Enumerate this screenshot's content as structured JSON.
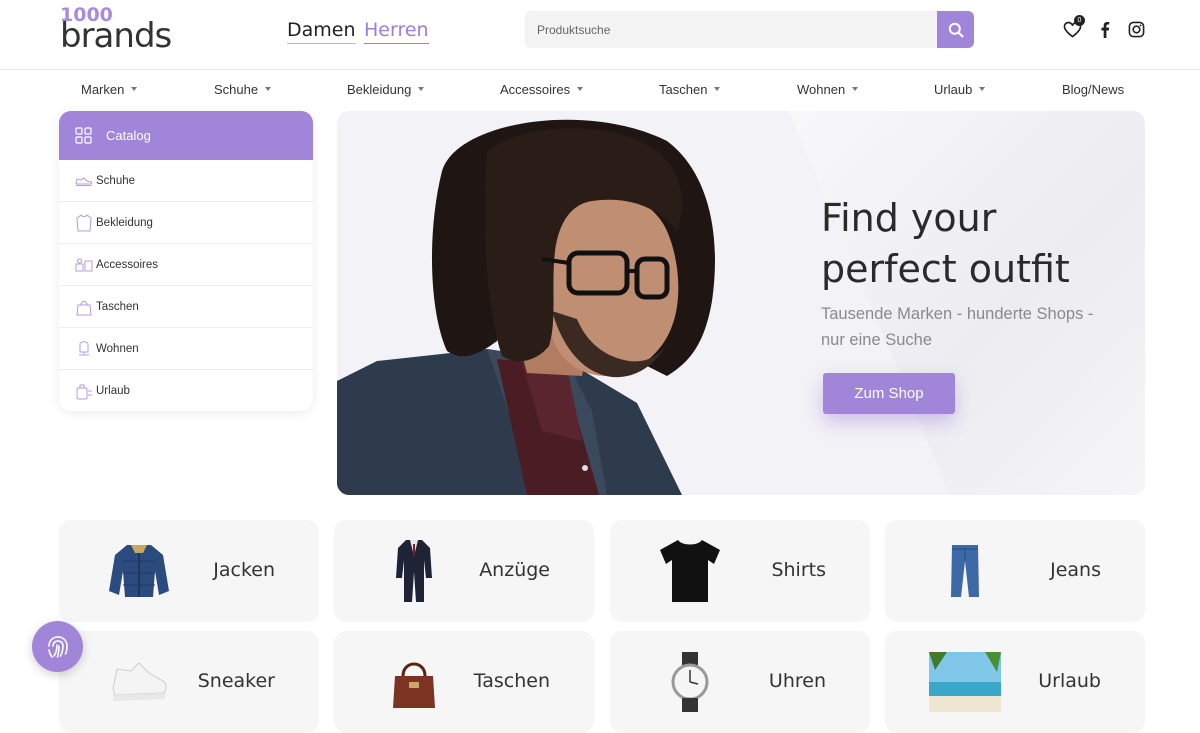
{
  "header": {
    "logo_num": "1000",
    "logo_word": "brands",
    "gender_tabs": [
      {
        "label": "Damen"
      },
      {
        "label": "Herren"
      }
    ],
    "search_placeholder": "Produktsuche",
    "wishlist_count": "0"
  },
  "nav": {
    "items": [
      {
        "label": "Marken"
      },
      {
        "label": "Schuhe"
      },
      {
        "label": "Bekleidung"
      },
      {
        "label": "Accessoires"
      },
      {
        "label": "Taschen"
      },
      {
        "label": "Wohnen"
      },
      {
        "label": "Urlaub"
      },
      {
        "label": "Blog/News"
      }
    ]
  },
  "catalog": {
    "title": "Catalog",
    "items": [
      {
        "label": "Schuhe",
        "icon": "shoe-icon"
      },
      {
        "label": "Bekleidung",
        "icon": "shirt-icon"
      },
      {
        "label": "Accessoires",
        "icon": "accessories-icon"
      },
      {
        "label": "Taschen",
        "icon": "bag-icon"
      },
      {
        "label": "Wohnen",
        "icon": "home-icon"
      },
      {
        "label": "Urlaub",
        "icon": "vacation-icon"
      }
    ]
  },
  "hero": {
    "title_line1": "Find your",
    "title_line2": "perfect outfit",
    "subtitle": "Tausende Marken - hunderte Shops - nur eine Suche",
    "button": "Zum Shop"
  },
  "tiles": [
    {
      "label": "Jacken"
    },
    {
      "label": "Anzüge"
    },
    {
      "label": "Shirts"
    },
    {
      "label": "Jeans"
    },
    {
      "label": "Sneaker"
    },
    {
      "label": "Taschen"
    },
    {
      "label": "Uhren"
    },
    {
      "label": "Urlaub"
    }
  ],
  "colors": {
    "accent": "#a185d8",
    "text": "#333333",
    "tile_bg": "#f6f6f6"
  }
}
